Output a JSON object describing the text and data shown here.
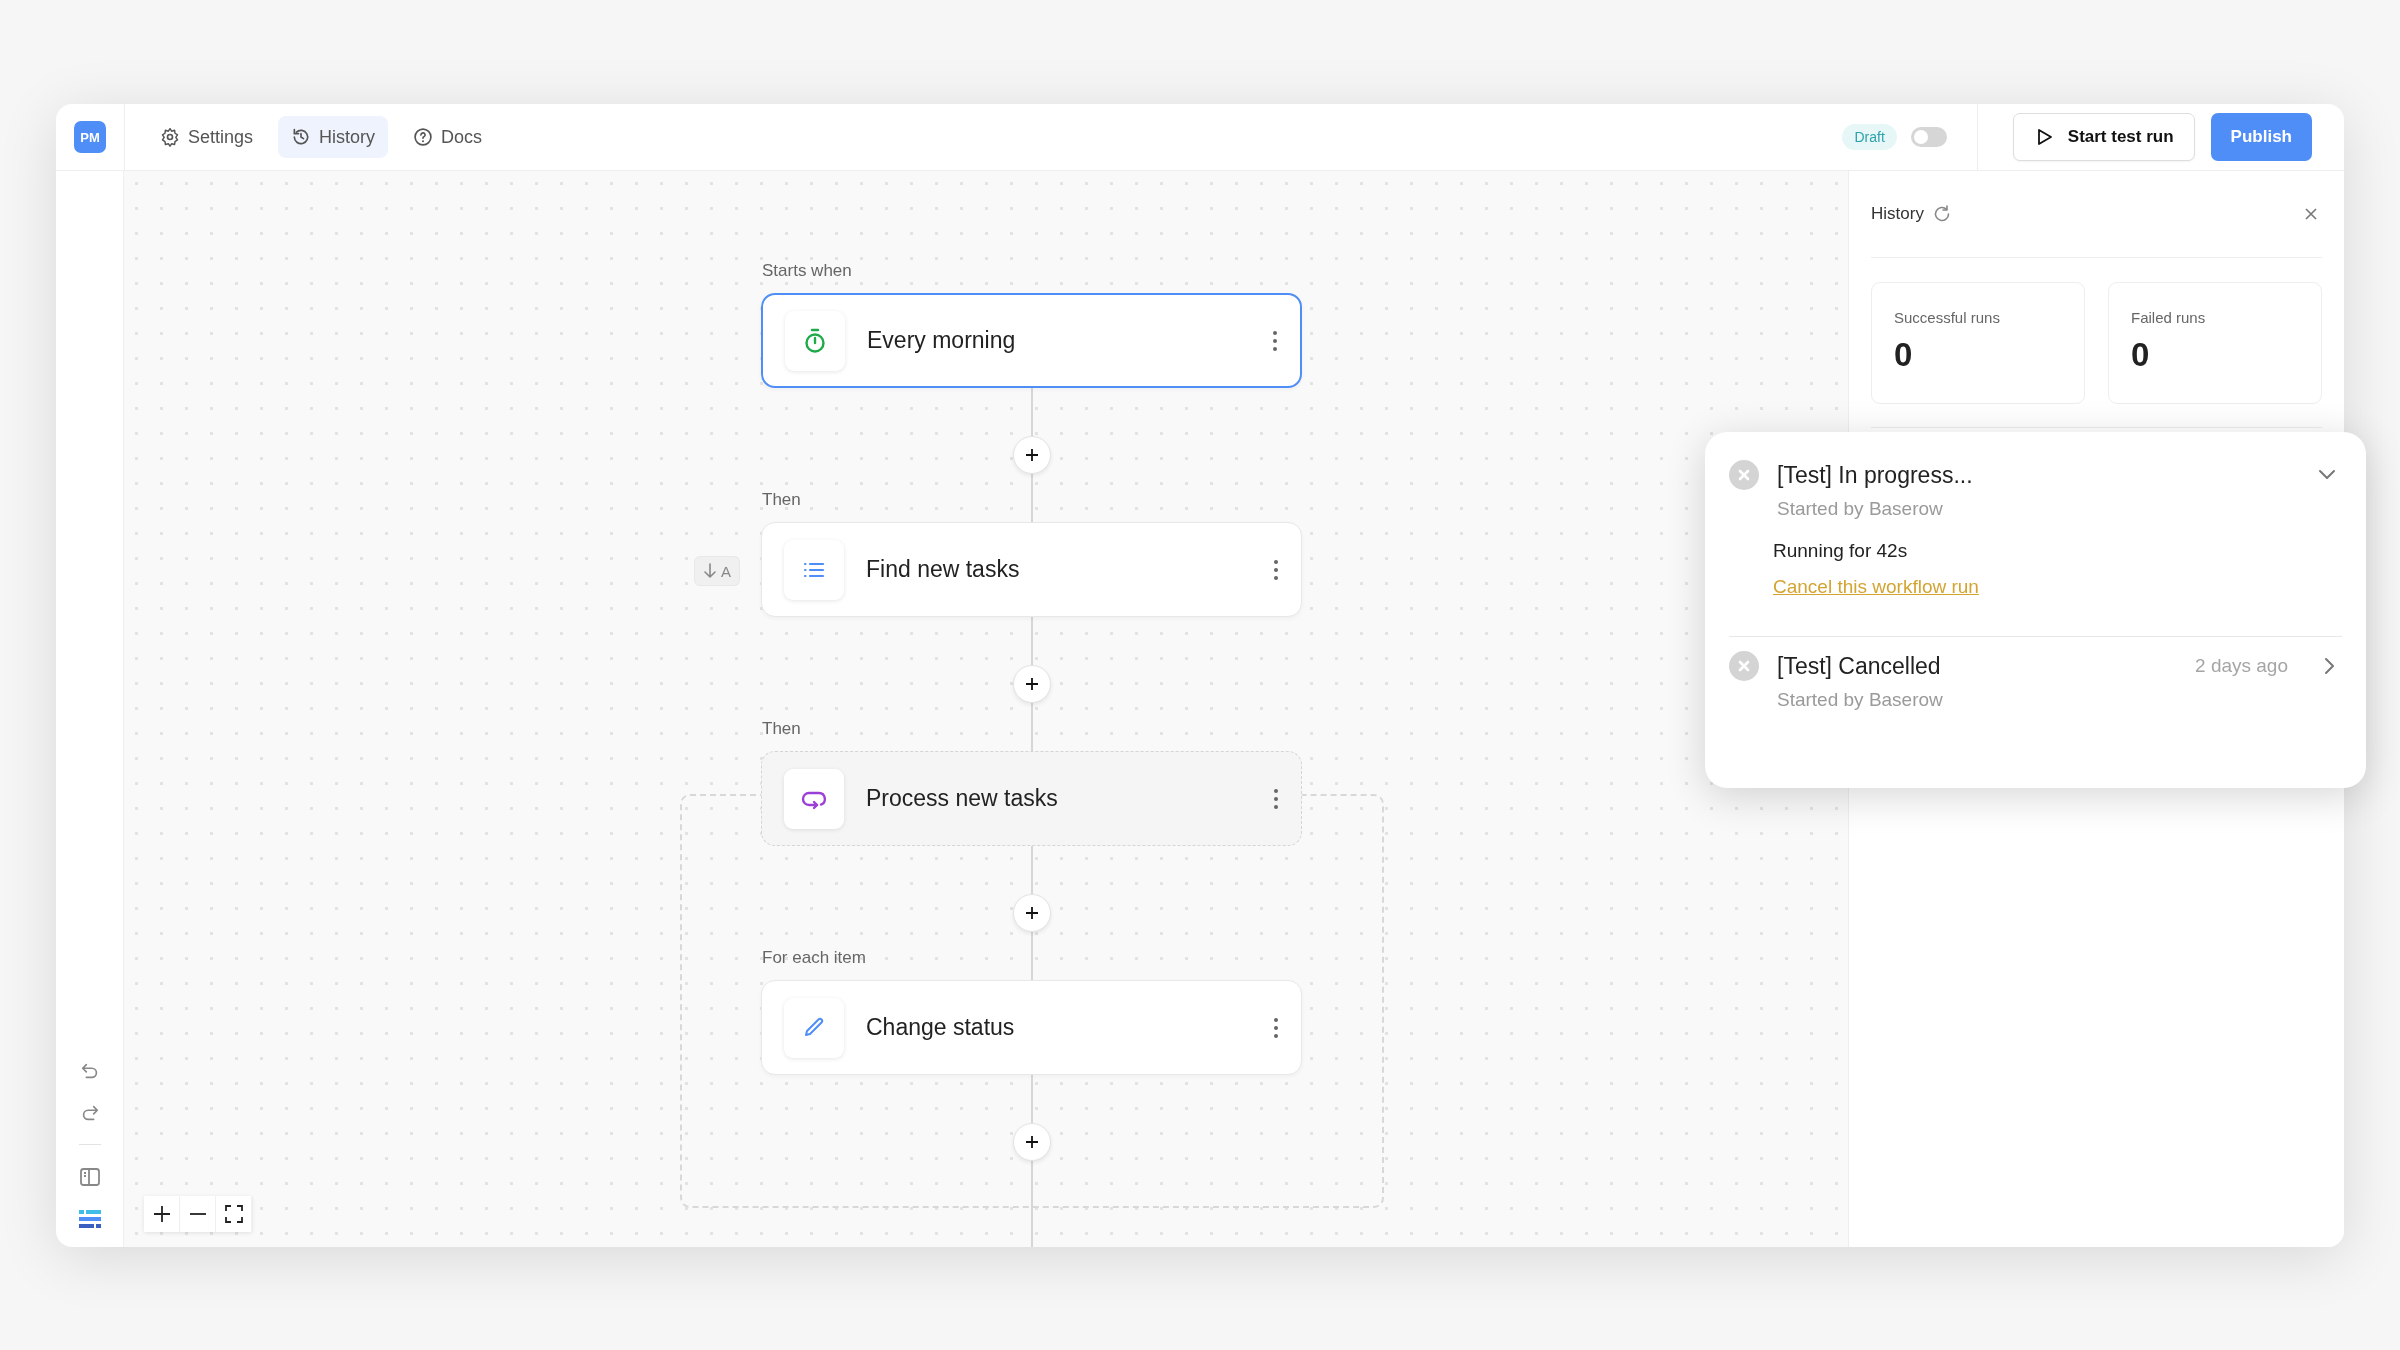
{
  "topbar": {
    "logo": "PM",
    "tabs": [
      {
        "label": "Settings",
        "selected": false
      },
      {
        "label": "History",
        "selected": true
      },
      {
        "label": "Docs",
        "selected": false
      }
    ],
    "status_badge": "Draft",
    "toggle": {
      "on": false
    },
    "test_button": "Start test run",
    "publish_button": "Publish"
  },
  "canvas": {
    "nodes": [
      {
        "section_label": "Starts when",
        "title": "Every morning",
        "selected": true
      },
      {
        "section_label": "Then",
        "title": "Find new tasks",
        "selected": false,
        "side_badge": "A"
      },
      {
        "section_label": "Then",
        "title": "Process new tasks",
        "selected": false,
        "children": [
          {
            "section_label": "For each item",
            "title": "Change status",
            "selected": false
          }
        ]
      }
    ]
  },
  "history": {
    "title": "History",
    "stats": [
      {
        "label": "Successful runs",
        "value": "0"
      },
      {
        "label": "Failed runs",
        "value": "0"
      }
    ]
  },
  "runs": [
    {
      "title": "[Test] In progress...",
      "subtitle": "Started by Baserow",
      "expanded": true,
      "detail": "Running for 42s",
      "link": "Cancel this workflow run"
    },
    {
      "title": "[Test] Cancelled",
      "subtitle": "Started by Baserow",
      "expanded": false,
      "time": "2 days ago"
    }
  ]
}
